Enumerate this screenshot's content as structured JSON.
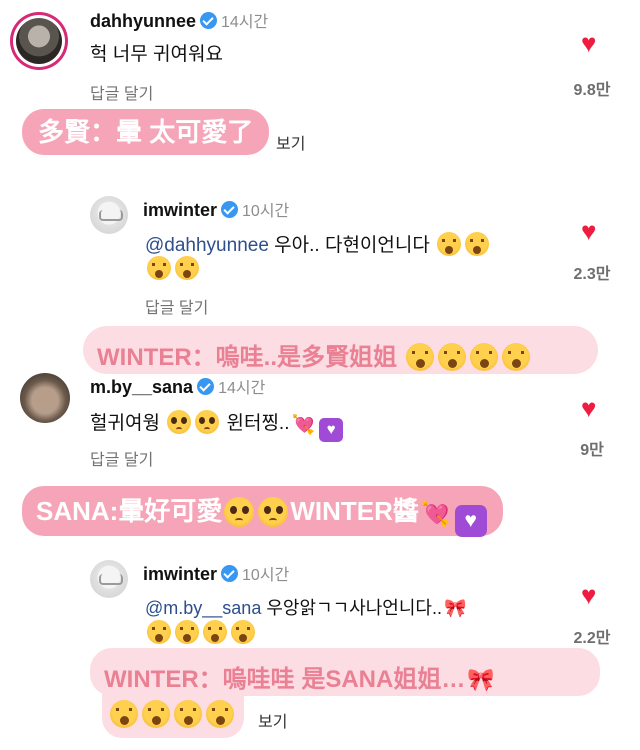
{
  "comments": [
    {
      "username": "dahhyunnee",
      "time": "14시간",
      "text": "헉 너무 귀여워요",
      "reply_label": "답글 달기",
      "likes": "9.8만",
      "translation": "多賢：暈 太可愛了",
      "translation_suffix": "보기"
    },
    {
      "username": "imwinter",
      "time": "10시간",
      "mention": "@dahhyunnee",
      "text": " 우아.. 다현이언니다",
      "reply_label": "답글 달기",
      "likes": "2.3만",
      "translation": "WINTER：嗚哇..是多賢姐姐"
    },
    {
      "username": "m.by__sana",
      "time": "14시간",
      "text": "헐귀여웡",
      "text_2": "윈터찡..",
      "reply_label": "답글 달기",
      "likes": "9만",
      "translation": "SANA:暈好可愛",
      "translation_2": "WINTER醬"
    },
    {
      "username": "imwinter",
      "time": "10시간",
      "mention": "@m.by__sana",
      "text": " 우앙앍ㄱㄱ사나언니다..",
      "likes": "2.2만",
      "translation": "WINTER：嗚哇哇 是SANA姐姐…",
      "translation_suffix": "보기"
    }
  ],
  "icons": {
    "heart": "heart-icon",
    "verified": "verified-badge-icon",
    "emoji_hushed": "hushed-face-emoji",
    "emoji_pleading": "pleading-face-emoji",
    "emoji_cupid": "heart-with-arrow-emoji",
    "emoji_purple_heart": "heart-decoration-emoji",
    "emoji_ribbon": "ribbon-emoji"
  },
  "colors": {
    "heart": "#ed1c40",
    "verified": "#3897f0",
    "pill_dark": "#f6a5b8",
    "pill_light": "#fcdde3",
    "pill_light_text": "#ea8093",
    "mention": "#2d4f8c"
  }
}
